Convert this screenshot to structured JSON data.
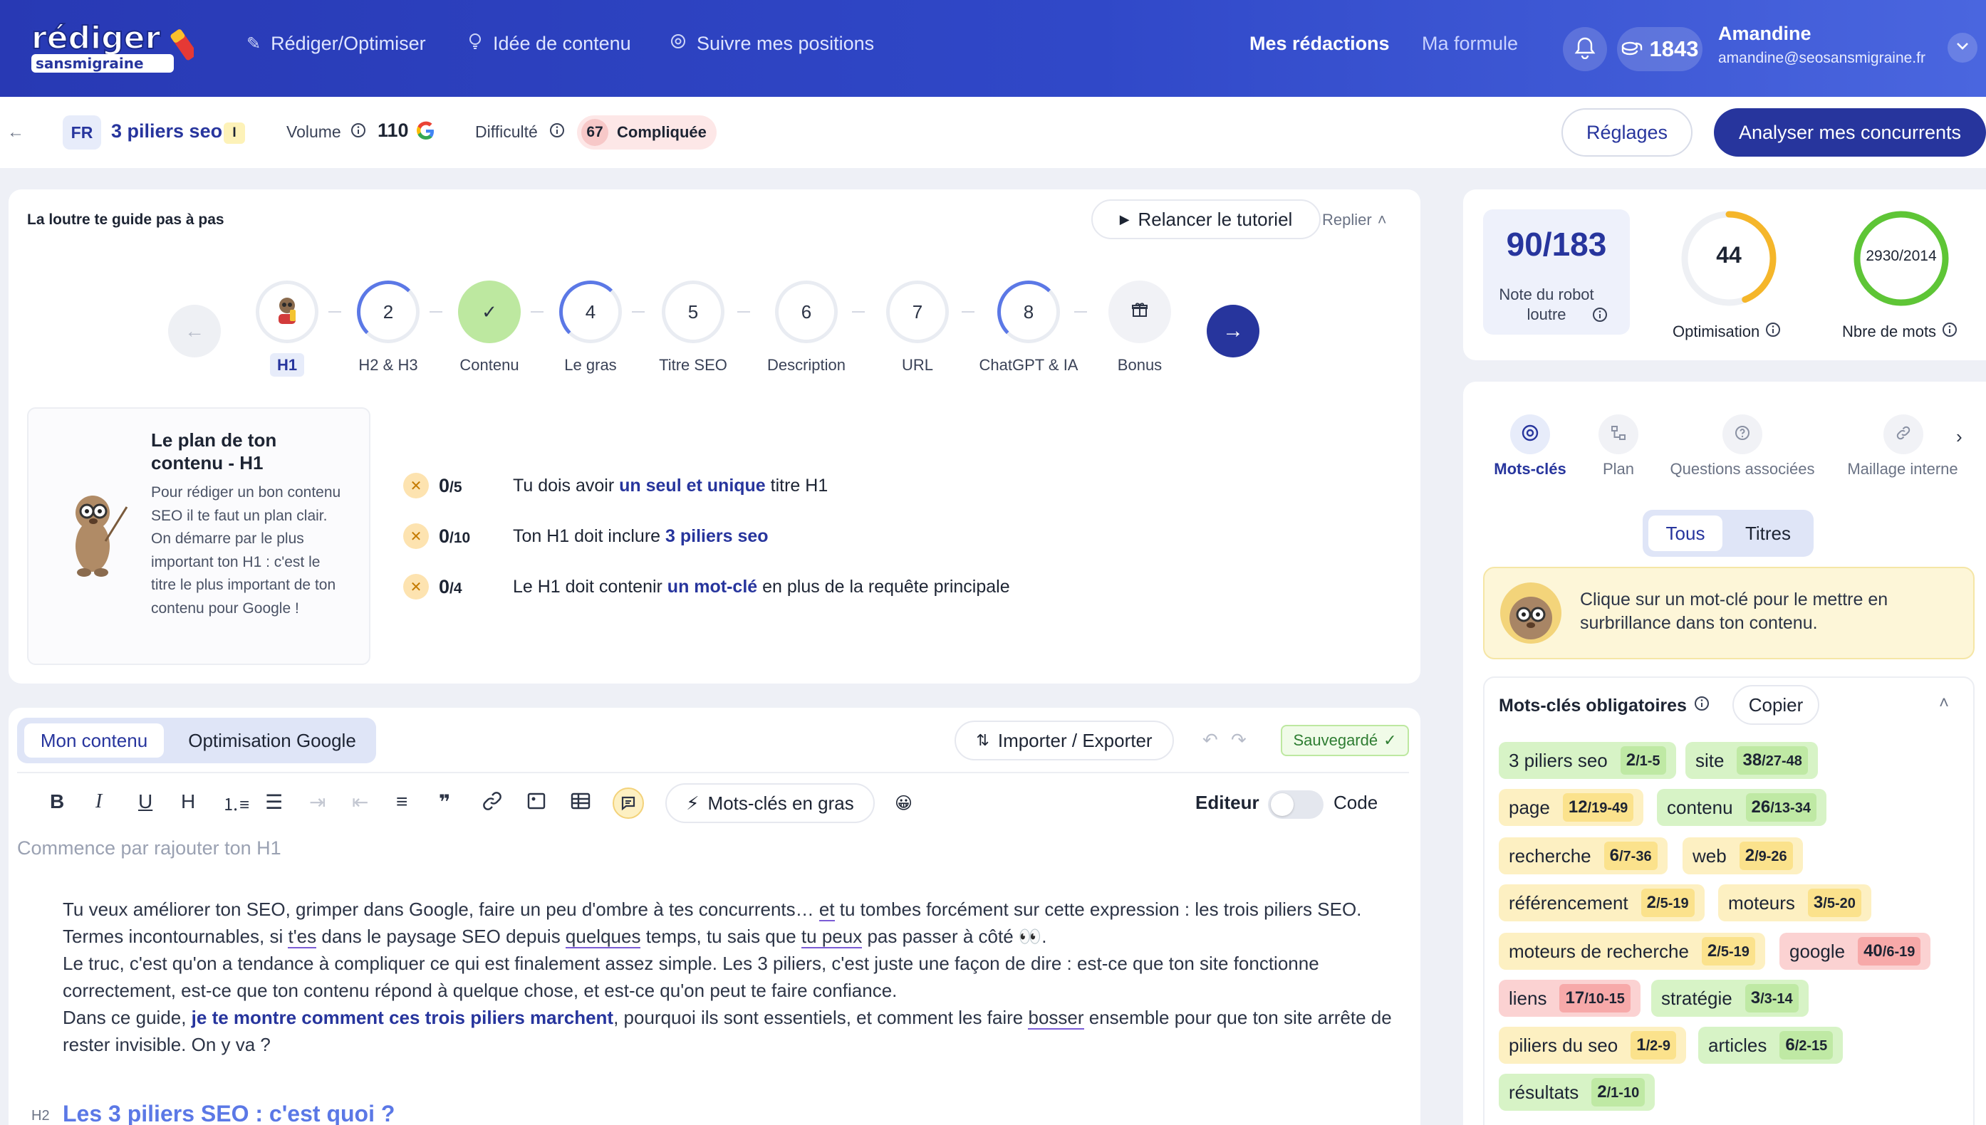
{
  "header": {
    "logo_line1": "rédiger",
    "logo_line2": "sansmigraine",
    "nav": [
      {
        "label": "Rédiger/Optimiser",
        "icon": "pencil-icon"
      },
      {
        "label": "Idée de contenu",
        "icon": "lightbulb-icon"
      },
      {
        "label": "Suivre mes positions",
        "icon": "target-icon"
      }
    ],
    "mes_redactions": "Mes rédactions",
    "ma_formule": "Ma formule",
    "credits": "1843",
    "user_name": "Amandine",
    "user_email": "amandine@seosansmigraine.fr"
  },
  "subbar": {
    "lang": "FR",
    "keyword": "3 piliers seo",
    "keyword_badge": "I",
    "volume_label": "Volume",
    "volume_value": "110",
    "difficulty_label": "Difficulté",
    "difficulty_value": "67",
    "difficulty_text": "Compliquée",
    "reglages": "Réglages",
    "analyser": "Analyser mes concurrents"
  },
  "guide": {
    "title": "La loutre te guide pas à pas",
    "relancer": "Relancer le tutoriel",
    "replier": "Replier",
    "steps": [
      {
        "num": "",
        "label": "H1",
        "state": "active"
      },
      {
        "num": "2",
        "label": "H2 & H3",
        "state": "half"
      },
      {
        "num": "✓",
        "label": "Contenu",
        "state": "done"
      },
      {
        "num": "4",
        "label": "Le gras",
        "state": "half"
      },
      {
        "num": "5",
        "label": "Titre SEO",
        "state": "todo"
      },
      {
        "num": "6",
        "label": "Description",
        "state": "todo"
      },
      {
        "num": "7",
        "label": "URL",
        "state": "todo"
      },
      {
        "num": "8",
        "label": "ChatGPT & IA",
        "state": "half"
      },
      {
        "num": "",
        "label": "Bonus",
        "state": "todo"
      }
    ],
    "plan_title": "Le plan de ton contenu - H1",
    "plan_text": "Pour rédiger un bon contenu SEO il te faut un plan clair. On démarre par le plus important ton H1 : c'est le titre le plus important de ton contenu pour Google !",
    "rules": [
      {
        "score": "0",
        "max": "/5",
        "pre": "Tu dois avoir ",
        "bold": "un seul et unique",
        "post": " titre H1"
      },
      {
        "score": "0",
        "max": "/10",
        "pre": "Ton H1 doit inclure ",
        "bold": "3 piliers seo",
        "post": ""
      },
      {
        "score": "0",
        "max": "/4",
        "pre": "Le H1 doit contenir ",
        "bold": "un mot-clé",
        "post": " en plus de la requête principale"
      }
    ]
  },
  "editor": {
    "tab_content": "Mon contenu",
    "tab_google": "Optimisation Google",
    "import_export": "Importer / Exporter",
    "saved": "Sauvegardé",
    "bold_keywords": "Mots-clés en gras",
    "editeur": "Editeur",
    "code": "Code",
    "placeholder": "Commence par rajouter ton H1",
    "p1_a": "Tu veux améliorer ton SEO, grimper dans Google, faire un peu d'ombre à tes concurrents… ",
    "p1_et": "et",
    "p1_b": " tu tombes forcément sur cette expression : les trois piliers SEO.",
    "p2_a": "Termes incontournables, si ",
    "p2_tes": "t'es",
    "p2_b": " dans le paysage SEO depuis ",
    "p2_quelques": "quelques",
    "p2_c": " temps, tu sais que ",
    "p2_tupeux": "tu peux",
    "p2_d": " pas passer à côté 👀.",
    "p3": "Le truc, c'est qu'on a tendance à compliquer ce qui est finalement assez simple. Les 3 piliers, c'est juste une façon de dire : est-ce que ton site fonctionne correctement, est-ce que ton contenu répond à quelque chose, et est-ce qu'on peut te faire confiance.",
    "p4_a": "Dans ce guide, ",
    "p4_bold": "je te montre comment ces trois piliers marchent",
    "p4_b": ", pourquoi ils sont essentiels, et comment les faire ",
    "p4_bosser": "bosser",
    "p4_c": " ensemble pour que ton site arrête de rester invisible. On y va ?",
    "h2_tag": "H2",
    "h2_text": "Les 3 piliers SEO : c'est quoi ?"
  },
  "scores": {
    "robot_score": "90/183",
    "robot_label": "Note du robot loutre",
    "optimisation_value": "44",
    "optimisation_pct": 44,
    "optimisation_label": "Optimisation",
    "words_value": "2930/2014",
    "words_label": "Nbre de mots"
  },
  "panel": {
    "tabs": [
      {
        "label": "Mots-clés",
        "icon": "target-icon"
      },
      {
        "label": "Plan",
        "icon": "tree-icon"
      },
      {
        "label": "Questions associées",
        "icon": "question-icon"
      },
      {
        "label": "Maillage interne",
        "icon": "link-icon"
      }
    ],
    "filter_all": "Tous",
    "filter_titles": "Titres",
    "tip": "Clique sur un mot-clé pour le mettre en surbrillance dans ton contenu.",
    "mandatory_title": "Mots-clés obligatoires",
    "copy": "Copier",
    "keywords": [
      {
        "word": "3 piliers seo",
        "count": "2",
        "range": "/1-5",
        "status": "green"
      },
      {
        "word": "site",
        "count": "38",
        "range": "/27-48",
        "status": "green"
      },
      {
        "word": "page",
        "count": "12",
        "range": "/19-49",
        "status": "yellow"
      },
      {
        "word": "contenu",
        "count": "26",
        "range": "/13-34",
        "status": "green"
      },
      {
        "word": "recherche",
        "count": "6",
        "range": "/7-36",
        "status": "yellow"
      },
      {
        "word": "web",
        "count": "2",
        "range": "/9-26",
        "status": "yellow"
      },
      {
        "word": "référencement",
        "count": "2",
        "range": "/5-19",
        "status": "yellow"
      },
      {
        "word": "moteurs",
        "count": "3",
        "range": "/5-20",
        "status": "yellow"
      },
      {
        "word": "moteurs de recherche",
        "count": "2",
        "range": "/5-19",
        "status": "yellow"
      },
      {
        "word": "google",
        "count": "40",
        "range": "/6-19",
        "status": "red"
      },
      {
        "word": "liens",
        "count": "17",
        "range": "/10-15",
        "status": "red"
      },
      {
        "word": "stratégie",
        "count": "3",
        "range": "/3-14",
        "status": "green"
      },
      {
        "word": "piliers du seo",
        "count": "1",
        "range": "/2-9",
        "status": "yellow"
      },
      {
        "word": "articles",
        "count": "6",
        "range": "/2-15",
        "status": "green"
      },
      {
        "word": "résultats",
        "count": "2",
        "range": "/1-10",
        "status": "green"
      }
    ]
  }
}
